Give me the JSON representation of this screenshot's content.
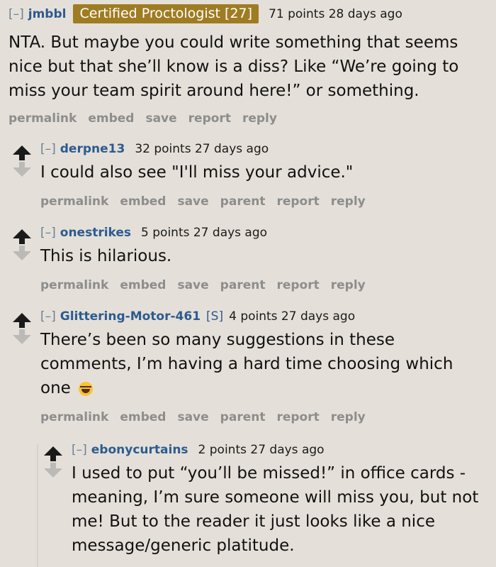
{
  "comments": [
    {
      "expand": "[–]",
      "author": "jmbbl",
      "flair": "Certified Proctologist [27]",
      "points": "71 points 28 days ago",
      "body": "NTA. But maybe you could write something that seems nice but that she’ll know is a diss? Like “We’re going to miss your team spirit around here!” or something.",
      "buttons": [
        "permalink",
        "embed",
        "save",
        "report",
        "reply"
      ]
    },
    {
      "expand": "[–]",
      "author": "derpne13",
      "points": "32 points 27 days ago",
      "body": "I could also see \"I'll miss your advice.\"",
      "buttons": [
        "permalink",
        "embed",
        "save",
        "parent",
        "report",
        "reply"
      ]
    },
    {
      "expand": "[–]",
      "author": "onestrikes",
      "points": "5 points 27 days ago",
      "body": "This is hilarious.",
      "buttons": [
        "permalink",
        "embed",
        "save",
        "parent",
        "report",
        "reply"
      ]
    },
    {
      "expand": "[–]",
      "author": "Glittering-Motor-461",
      "submitter": "[S]",
      "points": "4 points 27 days ago",
      "body": "There’s been so many suggestions in these comments, I’m having a hard time choosing which one",
      "emoji": "face-with-tears-of-joy",
      "buttons": [
        "permalink",
        "embed",
        "save",
        "parent",
        "report",
        "reply"
      ]
    },
    {
      "expand": "[–]",
      "author": "ebonycurtains",
      "points": "2 points 27 days ago",
      "body": "I used to put “you’ll be missed!” in office cards - meaning, I’m sure someone will miss you, but not me! But to the reader it just looks like a nice message/generic platitude."
    }
  ],
  "colors": {
    "background": "#e4e0d9",
    "author": "#2d5b8f",
    "flair_bg": "#9f7c22",
    "buttons": "#8d8d8d"
  }
}
